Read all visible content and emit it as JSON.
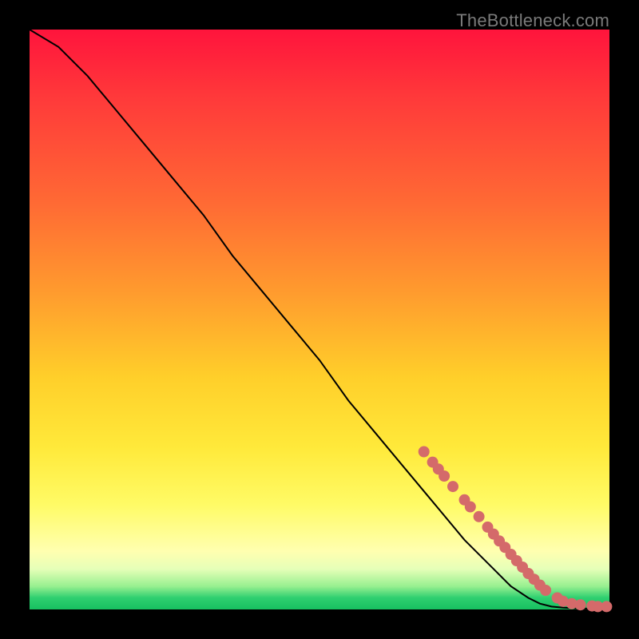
{
  "watermark": "TheBottleneck.com",
  "chart_data": {
    "type": "line",
    "title": "",
    "xlabel": "",
    "ylabel": "",
    "xlim": [
      0,
      100
    ],
    "ylim": [
      0,
      100
    ],
    "grid": false,
    "legend": false,
    "series": [
      {
        "name": "curve",
        "x": [
          0,
          5,
          10,
          15,
          20,
          25,
          30,
          35,
          40,
          45,
          50,
          55,
          60,
          65,
          70,
          75,
          80,
          83,
          86,
          88,
          90,
          92,
          94,
          96,
          98,
          100
        ],
        "y": [
          100,
          97,
          92,
          86,
          80,
          74,
          68,
          61,
          55,
          49,
          43,
          36,
          30,
          24,
          18,
          12,
          7,
          4,
          2,
          1,
          0.5,
          0.3,
          0.2,
          0.15,
          0.1,
          0.1
        ]
      }
    ],
    "markers": {
      "name": "highlighted-points",
      "color": "#d46a6a",
      "x": [
        68,
        69.5,
        70.5,
        71.5,
        73,
        75,
        76,
        77.5,
        79,
        80,
        81,
        82,
        83,
        84,
        85,
        86,
        87,
        88,
        89,
        91,
        92,
        93.5,
        95,
        97,
        98,
        99.5
      ],
      "y": [
        27.2,
        25.4,
        24.2,
        23,
        21.2,
        18.9,
        17.7,
        16,
        14.2,
        13,
        11.8,
        10.7,
        9.5,
        8.4,
        7.3,
        6.2,
        5.2,
        4.2,
        3.3,
        2,
        1.4,
        1,
        0.8,
        0.6,
        0.5,
        0.5
      ]
    },
    "background_gradient": {
      "direction": "vertical",
      "stops": [
        {
          "pos": 0,
          "color": "#ff143c"
        },
        {
          "pos": 30,
          "color": "#ff6a34"
        },
        {
          "pos": 60,
          "color": "#ffcf2a"
        },
        {
          "pos": 82,
          "color": "#fffb66"
        },
        {
          "pos": 96,
          "color": "#98f090"
        },
        {
          "pos": 100,
          "color": "#17c060"
        }
      ]
    }
  }
}
